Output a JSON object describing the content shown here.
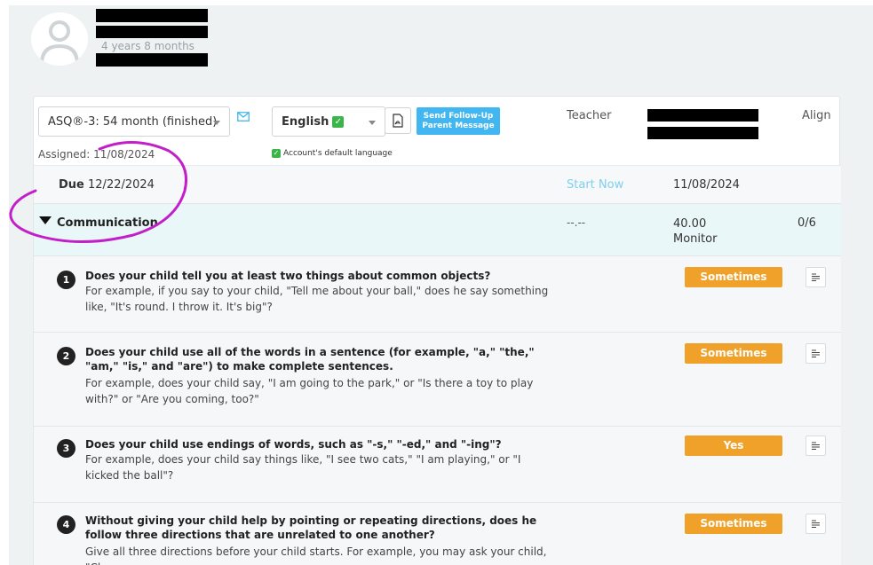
{
  "profile": {
    "age": "4 years 8 months"
  },
  "controls": {
    "questionnaire_select": "ASQ®-3: 54 month (finished)",
    "language_select": "English",
    "followup_button": "Send Follow-Up Parent Message",
    "assigned": "Assigned: 11/08/2024",
    "default_language_note": "Account's default language",
    "teacher_label": "Teacher",
    "align_label": "Align"
  },
  "due": {
    "label": "Due",
    "date": "12/22/2024",
    "start_now": "Start Now",
    "start_date": "11/08/2024"
  },
  "section": {
    "title": "Communication",
    "dash": "--.--",
    "score": "40.00",
    "status": "Monitor",
    "count": "0/6"
  },
  "questions": [
    {
      "number": "1",
      "title": "Does your child tell you at least two things about common objects?",
      "body": "For example, if you say to your child, \"Tell me about your ball,\" does he say something like, \"It's round. I throw it. It's big\"?",
      "answer": "Sometimes"
    },
    {
      "number": "2",
      "title": "Does your child use all of the words in a sentence (for example, \"a,\" \"the,\" \"am,\" \"is,\" and \"are\") to make complete sentences.",
      "body": "For example, does your child say, \"I am going to the park,\" or \"Is there a toy to play with?\" or \"Are you coming, too?\"",
      "answer": "Sometimes"
    },
    {
      "number": "3",
      "title": "Does your child use endings of words, such as \"-s,\" \"-ed,\" and \"-ing\"?",
      "body": "For example, does your child say things like, \"I see two cats,\" \"I am playing,\" or \"I kicked the ball\"?",
      "answer": "Yes"
    },
    {
      "number": "4",
      "title": "Without giving your child help by pointing or repeating directions, does he follow three directions that are unrelated to one another?",
      "body": "Give all three directions before your child starts. For example, you may ask your child, \"Clap",
      "answer": "Sometimes"
    }
  ],
  "colors": {
    "accent_blue": "#42b6f0",
    "answer_orange": "#f0a12a",
    "highlight_magenta": "#c21fc9",
    "section_bg": "#eaf7f9"
  }
}
